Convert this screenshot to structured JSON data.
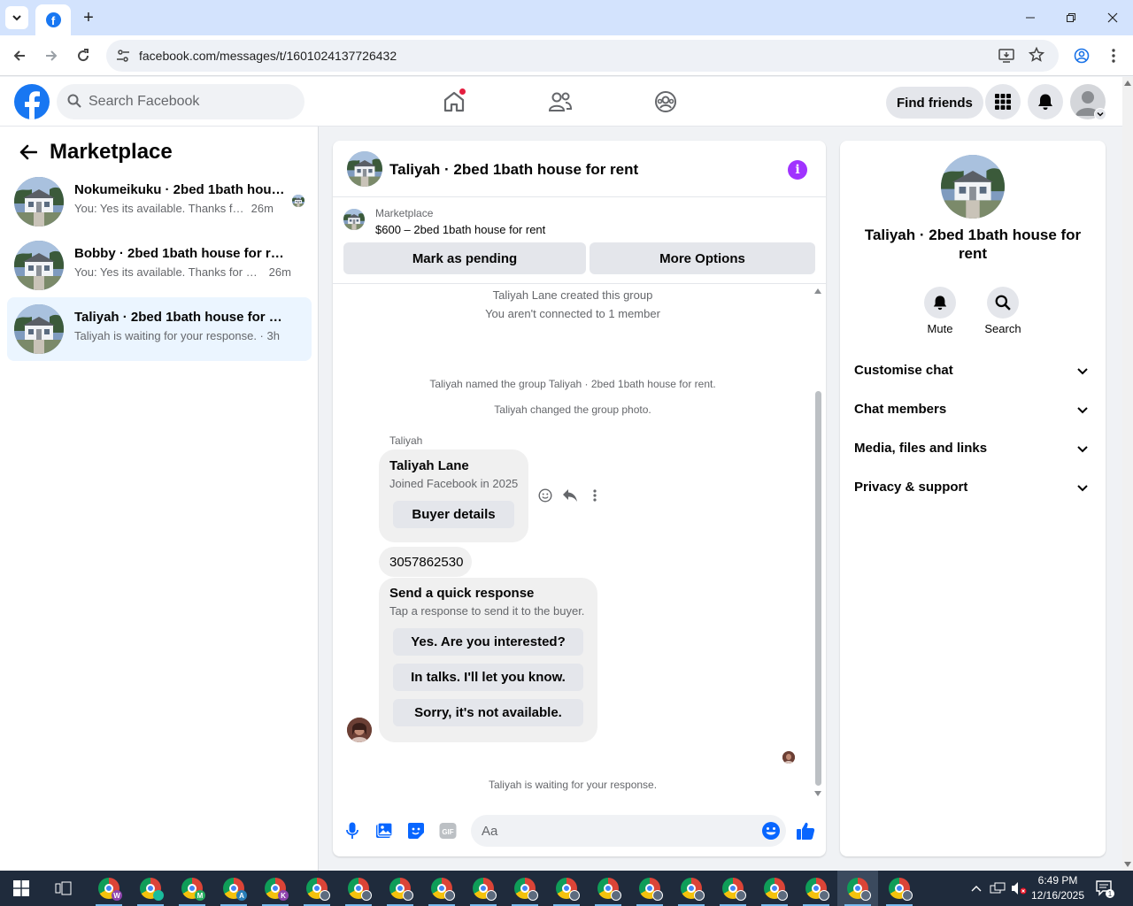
{
  "browser": {
    "url": "facebook.com/messages/t/1601024137726432",
    "new_tab_symbol": "+",
    "window_controls": [
      "minimize",
      "restore",
      "close"
    ]
  },
  "fb_header": {
    "logo": "facebook-logo",
    "search_placeholder": "Search Facebook",
    "nav": [
      "home-icon",
      "friends-icon",
      "groups-icon"
    ],
    "find_friends_label": "Find friends",
    "icons": [
      "menu-grid-icon",
      "notifications-icon",
      "account-avatar"
    ]
  },
  "sidebar": {
    "title": "Marketplace",
    "conversations": [
      {
        "title": "Nokumeikuku · 2bed 1bath house for rent",
        "snippet": "You: Yes its available. Thanks for ...",
        "time": "26m",
        "active": false
      },
      {
        "title": "Bobby · 2bed 1bath house for rent",
        "snippet": "You: Yes its available. Thanks for me...",
        "time": "26m",
        "active": false
      },
      {
        "title": "Taliyah · 2bed 1bath house for rent",
        "snippet": "Taliyah is waiting for your response.",
        "time": "3h",
        "active": true
      }
    ]
  },
  "chat": {
    "title": "Taliyah · 2bed 1bath house for rent",
    "marketplace_label": "Marketplace",
    "listing": "$600 – 2bed 1bath house for rent",
    "mark_pending_label": "Mark as pending",
    "more_options_label": "More Options",
    "system": {
      "created": "Taliyah Lane created this group",
      "not_connected": "You aren't connected to 1 member",
      "named": "Taliyah named the group Taliyah · 2bed 1bath house for rent.",
      "photo": "Taliyah changed the group photo."
    },
    "sender_name": "Taliyah",
    "card": {
      "name": "Taliyah Lane",
      "joined": "Joined Facebook in 2025",
      "buyer_details_label": "Buyer details"
    },
    "phone_message": "3057862530",
    "quick_response": {
      "title": "Send a quick response",
      "subtitle": "Tap a response to send it to the buyer.",
      "options": [
        "Yes. Are you interested?",
        "In talks. I'll let you know.",
        "Sorry, it's not available."
      ]
    },
    "waiting": "Taliyah is waiting for your response.",
    "composer_placeholder": "Aa",
    "composer_gif": "GIF"
  },
  "details": {
    "title": "Taliyah · 2bed 1bath house for rent",
    "mute_label": "Mute",
    "search_label": "Search",
    "sections": [
      "Customise chat",
      "Chat members",
      "Media, files and links",
      "Privacy & support"
    ]
  },
  "taskbar": {
    "time": "6:49 PM",
    "date": "12/16/2025",
    "notification_count": "1",
    "profile_badges": [
      {
        "letter": "W",
        "color": "#8e44ad"
      },
      {
        "letter": "",
        "color": "#1abc9c"
      },
      {
        "letter": "M",
        "color": "#27ae60"
      },
      {
        "letter": "A",
        "color": "#2980b9"
      },
      {
        "letter": "K",
        "color": "#8e44ad"
      }
    ]
  },
  "colors": {
    "fb_blue": "#1877f2",
    "active_conversation": "#ebf5ff",
    "info_purple": "#a033ff",
    "browser_tabbar": "#d3e3fd"
  }
}
